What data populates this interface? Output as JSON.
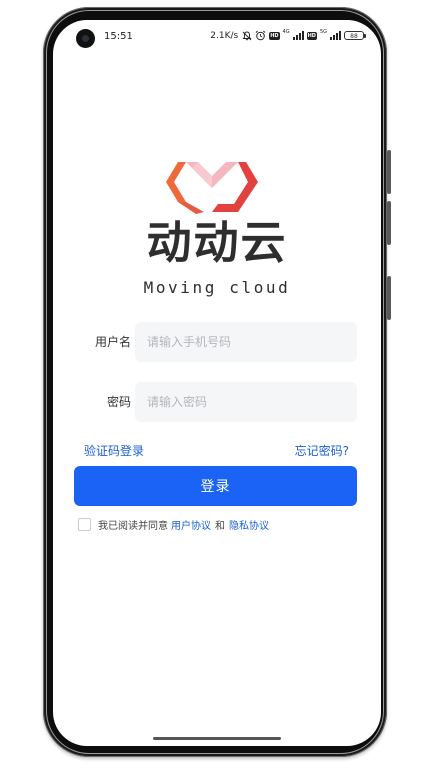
{
  "status_bar": {
    "time": "15:51",
    "net_speed": "2.1K/s",
    "sim1_badge": "HD",
    "sim1_network": "4G",
    "sim2_badge": "HD",
    "sim2_network": "5G",
    "battery": "88",
    "icons": [
      "mute-bell-icon",
      "alarm-icon",
      "signal-icon",
      "battery-icon"
    ]
  },
  "brand": {
    "name_cn": "动动云",
    "name_en": "Moving cloud",
    "logo_colors": {
      "orange": "#ef6a3a",
      "red": "#e2413f",
      "pink": "#f5b7bf"
    }
  },
  "form": {
    "username_label": "用户名",
    "username_placeholder": "请输入手机号码",
    "username_value": "",
    "password_label": "密码",
    "password_placeholder": "请输入密码",
    "password_value": ""
  },
  "links": {
    "sms_login": "验证码登录",
    "forgot_password": "忘记密码?"
  },
  "login_button": "登录",
  "agreement": {
    "checked": false,
    "prefix": "我已阅读并同意",
    "user_agreement": "用户协议",
    "conjunction": "和",
    "privacy_policy": "隐私协议"
  },
  "colors": {
    "primary": "#1b63f5",
    "link": "#1a5fd6",
    "input_bg": "#f5f6f8"
  }
}
